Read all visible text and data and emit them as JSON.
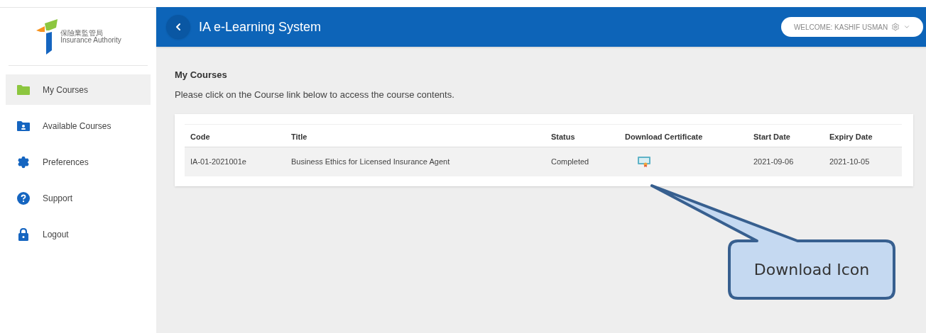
{
  "logo": {
    "name_zh": "保險業監管局",
    "name_en": "Insurance Authority"
  },
  "sidebar": {
    "items": [
      {
        "label": "My Courses",
        "selected": true
      },
      {
        "label": "Available Courses",
        "selected": false
      },
      {
        "label": "Preferences",
        "selected": false
      },
      {
        "label": "Support",
        "selected": false
      },
      {
        "label": "Logout",
        "selected": false
      }
    ]
  },
  "header": {
    "title": "IA e-Learning System",
    "user_menu": "WELCOME: KASHIF USMAN"
  },
  "content": {
    "heading": "My Courses",
    "instruction": "Please click on the Course link below to access the course contents."
  },
  "table": {
    "columns": [
      "Code",
      "Title",
      "Status",
      "Download Certificate",
      "Start Date",
      "Expiry Date"
    ],
    "rows": [
      {
        "code": "IA-01-2021001e",
        "title": "Business Ethics for Licensed Insurance Agent",
        "status": "Completed",
        "start_date": "2021-09-06",
        "expiry_date": "2021-10-05"
      }
    ]
  },
  "callout": {
    "text": "Download Icon"
  }
}
